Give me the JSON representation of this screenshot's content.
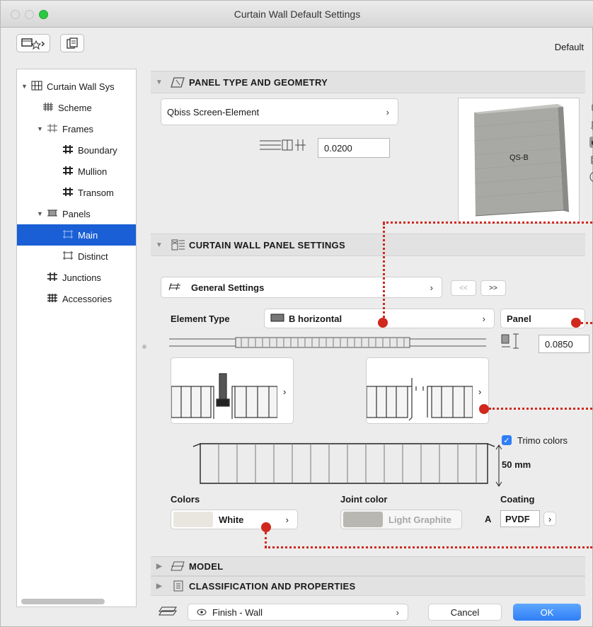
{
  "window": {
    "title": "Curtain Wall Default Settings"
  },
  "toolbar": {
    "default_label": "Default"
  },
  "sidebar": {
    "items": [
      {
        "label": "Curtain Wall Sys",
        "level": 0,
        "expanded": true,
        "icon": "curtain-wall-icon"
      },
      {
        "label": "Scheme",
        "level": 1,
        "icon": "scheme-icon"
      },
      {
        "label": "Frames",
        "level": 1,
        "expanded": true,
        "icon": "frames-icon"
      },
      {
        "label": "Boundary",
        "level": 2,
        "icon": "frame-icon"
      },
      {
        "label": "Mullion",
        "level": 2,
        "icon": "frame-icon"
      },
      {
        "label": "Transom",
        "level": 2,
        "icon": "frame-icon"
      },
      {
        "label": "Panels",
        "level": 1,
        "expanded": true,
        "icon": "panels-icon"
      },
      {
        "label": "Main",
        "level": 2,
        "selected": true,
        "icon": "panel-icon"
      },
      {
        "label": "Distinct",
        "level": 2,
        "icon": "panel-icon"
      },
      {
        "label": "Junctions",
        "level": 1,
        "icon": "junction-icon"
      },
      {
        "label": "Accessories",
        "level": 1,
        "icon": "accessories-icon"
      }
    ]
  },
  "panel_type": {
    "header": "PANEL TYPE AND GEOMETRY",
    "type_select": "Qbiss Screen-Element",
    "thickness_value": "0.0200",
    "preview_label": "QS-B"
  },
  "panel_settings": {
    "header": "CURTAIN WALL PANEL SETTINGS",
    "page_select": "General Settings",
    "prev_label": "<<",
    "next_label": ">>",
    "element_type_label": "Element Type",
    "element_type_value": "B horizontal",
    "panel_select": "Panel",
    "panel_depth_value": "0.0850",
    "trimo_colors_label": "Trimo colors",
    "trimo_colors_checked": true,
    "thickness_label": "50 mm",
    "colors_label": "Colors",
    "color_value": "White",
    "joint_color_label": "Joint color",
    "joint_color_value": "Light Graphite",
    "coating_label": "Coating",
    "coating_prefix": "A",
    "coating_value": "PVDF"
  },
  "model": {
    "header": "MODEL"
  },
  "classification": {
    "header": "CLASSIFICATION AND PROPERTIES"
  },
  "footer": {
    "layer_value": "Finish - Wall",
    "cancel_label": "Cancel",
    "ok_label": "OK"
  },
  "colors": {
    "accent": "#1a5fd5",
    "annotation_red": "#d0281c",
    "white_swatch": "#e8e6df",
    "graphite_swatch": "#b9b7b2"
  }
}
